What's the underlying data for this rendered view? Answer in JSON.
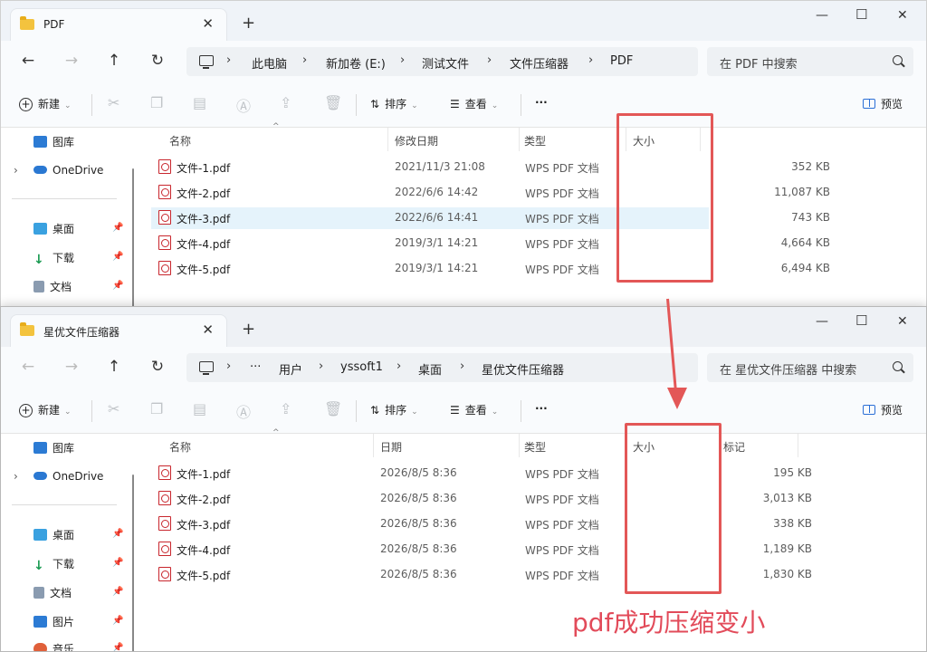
{
  "colors": {
    "accent": "#2b6fd6",
    "highlight_red": "#e35757",
    "selected_row": "#e5f3fb",
    "pdf_red": "#c8262d"
  },
  "window1": {
    "tab_title": "PDF",
    "breadcrumbs": [
      "此电脑",
      "新加卷 (E:)",
      "测试文件",
      "文件压缩器",
      "PDF"
    ],
    "search_placeholder": "在 PDF 中搜索",
    "toolbar": {
      "new": "新建",
      "sort": "排序",
      "view": "查看",
      "more": "···",
      "preview": "预览"
    },
    "sidebar": [
      {
        "label": "图库",
        "icon": "gallery-icon"
      },
      {
        "label": "OneDrive",
        "icon": "onedrive-icon"
      },
      {
        "label": "桌面",
        "icon": "desktop-icon"
      },
      {
        "label": "下载",
        "icon": "download-icon"
      },
      {
        "label": "文档",
        "icon": "document-icon"
      }
    ],
    "columns": {
      "name": "名称",
      "date": "修改日期",
      "type": "类型",
      "size": "大小"
    },
    "files": [
      {
        "name": "文件-1.pdf",
        "date": "2021/11/3 21:08",
        "type": "WPS PDF 文档",
        "size": "352 KB"
      },
      {
        "name": "文件-2.pdf",
        "date": "2022/6/6 14:42",
        "type": "WPS PDF 文档",
        "size": "11,087 KB"
      },
      {
        "name": "文件-3.pdf",
        "date": "2022/6/6 14:41",
        "type": "WPS PDF 文档",
        "size": "743 KB"
      },
      {
        "name": "文件-4.pdf",
        "date": "2019/3/1 14:21",
        "type": "WPS PDF 文档",
        "size": "4,664 KB"
      },
      {
        "name": "文件-5.pdf",
        "date": "2019/3/1 14:21",
        "type": "WPS PDF 文档",
        "size": "6,494 KB"
      }
    ]
  },
  "window2": {
    "tab_title": "星优文件压缩器",
    "breadcrumbs": [
      "···",
      "用户",
      "yssoft1",
      "桌面",
      "星优文件压缩器"
    ],
    "search_placeholder": "在 星优文件压缩器 中搜索",
    "toolbar": {
      "new": "新建",
      "sort": "排序",
      "view": "查看",
      "more": "···",
      "preview": "预览"
    },
    "sidebar": [
      {
        "label": "图库",
        "icon": "gallery-icon"
      },
      {
        "label": "OneDrive",
        "icon": "onedrive-icon"
      },
      {
        "label": "桌面",
        "icon": "desktop-icon"
      },
      {
        "label": "下载",
        "icon": "download-icon"
      },
      {
        "label": "文档",
        "icon": "document-icon"
      },
      {
        "label": "图片",
        "icon": "pictures-icon"
      },
      {
        "label": "音乐",
        "icon": "music-icon"
      }
    ],
    "columns": {
      "name": "名称",
      "date": "日期",
      "type": "类型",
      "size": "大小",
      "tag": "标记"
    },
    "files": [
      {
        "name": "文件-1.pdf",
        "date": "2026/8/5 8:36",
        "type": "WPS PDF 文档",
        "size": "195 KB"
      },
      {
        "name": "文件-2.pdf",
        "date": "2026/8/5 8:36",
        "type": "WPS PDF 文档",
        "size": "3,013 KB"
      },
      {
        "name": "文件-3.pdf",
        "date": "2026/8/5 8:36",
        "type": "WPS PDF 文档",
        "size": "338 KB"
      },
      {
        "name": "文件-4.pdf",
        "date": "2026/8/5 8:36",
        "type": "WPS PDF 文档",
        "size": "1,189 KB"
      },
      {
        "name": "文件-5.pdf",
        "date": "2026/8/5 8:36",
        "type": "WPS PDF 文档",
        "size": "1,830 KB"
      }
    ]
  },
  "annotation": "pdf成功压缩变小"
}
